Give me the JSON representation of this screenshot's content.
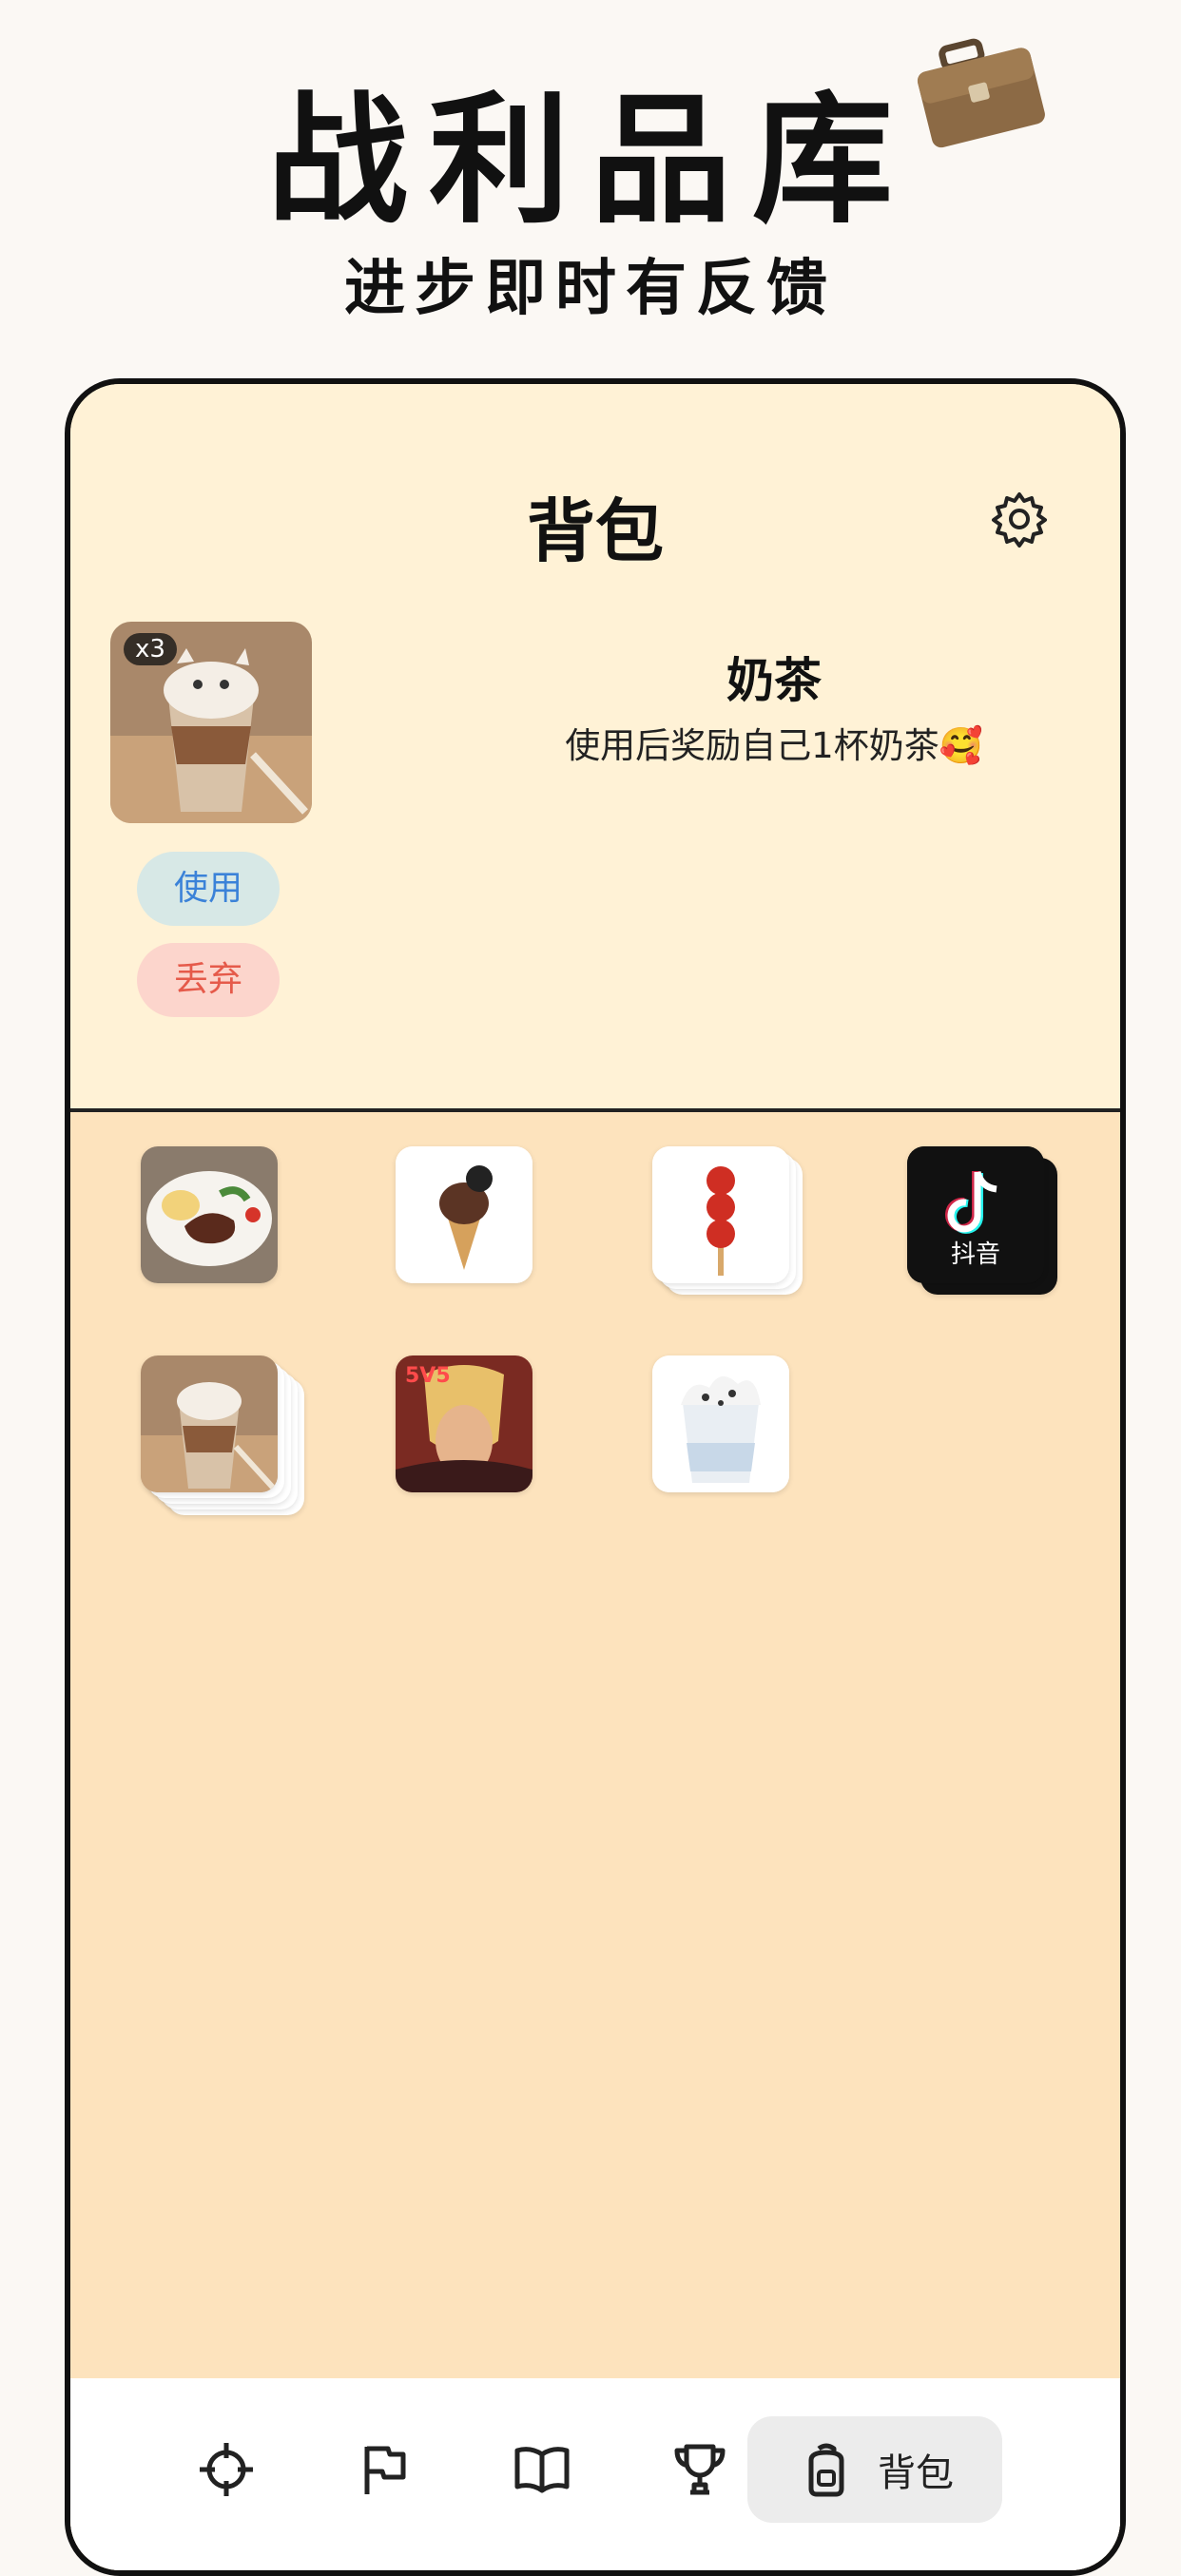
{
  "header": {
    "title": "战利品库",
    "subtitle": "进步即时有反馈"
  },
  "backpack": {
    "title": "背包",
    "selected_item": {
      "quantity_badge": "x3",
      "name": "奶茶",
      "description": "使用后奖励自己1杯奶茶🥰"
    },
    "use_label": "使用",
    "discard_label": "丢弃",
    "items": [
      {
        "icon": "steak-image"
      },
      {
        "icon": "ice-cream-cone-image"
      },
      {
        "icon": "candied-haws-image"
      },
      {
        "icon": "douyin-app-icon",
        "text": "抖音"
      },
      {
        "icon": "milk-tea-image"
      },
      {
        "icon": "game-hero-image",
        "text": "5V5"
      },
      {
        "icon": "mcflurry-image"
      }
    ]
  },
  "tabbar": {
    "tabs": [
      {
        "icon": "target-icon"
      },
      {
        "icon": "flag-icon"
      },
      {
        "icon": "book-icon"
      },
      {
        "icon": "trophy-icon"
      },
      {
        "icon": "backpack-icon",
        "label": "背包",
        "active": true
      }
    ]
  },
  "colors": {
    "top_panel": "#fff2d6",
    "bottom_panel": "#fde3bd",
    "use_text": "#3b82d8",
    "discard_text": "#e55a4a"
  }
}
